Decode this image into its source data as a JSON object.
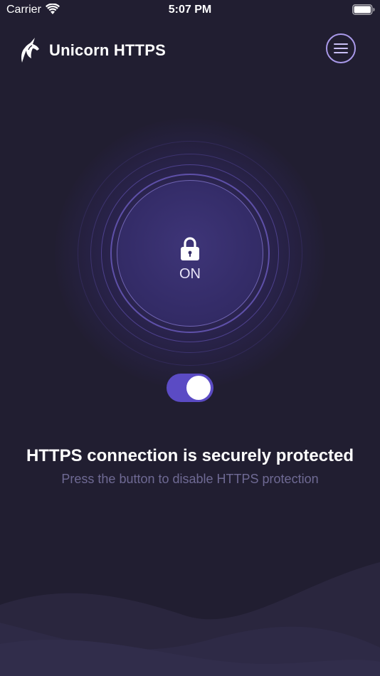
{
  "status_bar": {
    "carrier": "Carrier",
    "time": "5:07 PM",
    "wifi_icon": "wifi-icon",
    "battery_icon": "battery-full-icon"
  },
  "header": {
    "title": "Unicorn HTTPS",
    "logo_icon": "unicorn-logo-icon",
    "menu_icon": "hamburger-menu-icon"
  },
  "shield": {
    "status": "ON",
    "icon": "lock-icon"
  },
  "toggle": {
    "enabled": true
  },
  "message": {
    "headline": "HTTPS connection is securely protected",
    "subline": "Press the button to disable HTTPS protection"
  },
  "colors": {
    "background": "#211e31",
    "accent": "#5b4bc4",
    "ring": "#a999e9",
    "muted_text": "#6f6a94"
  }
}
